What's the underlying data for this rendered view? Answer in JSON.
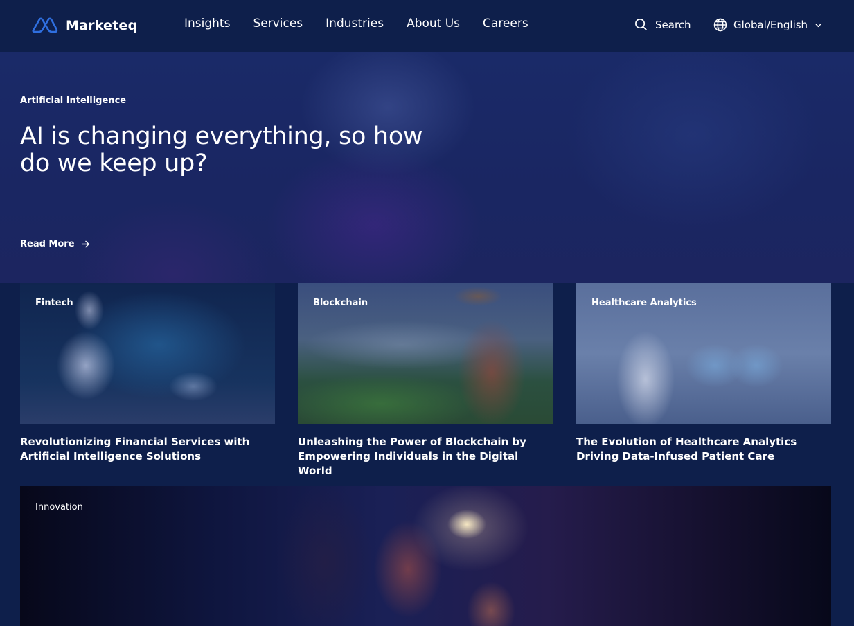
{
  "header": {
    "brand": "Marketeq",
    "brand_color": "#2f6fe0",
    "nav": [
      "Insights",
      "Services",
      "Industries",
      "About Us",
      "Careers"
    ],
    "search_label": "Search",
    "language_label": "Global/English"
  },
  "hero": {
    "category": "Artificial Intelligence",
    "title": "AI is changing everything, so how do we keep up?",
    "cta_label": "Read More"
  },
  "cards": [
    {
      "category": "Fintech",
      "title": "Revolutionizing Financial Services with Artificial Intelligence Solutions"
    },
    {
      "category": "Blockchain",
      "title": "Unleashing the Power of Blockchain by Empowering Individuals in the Digital World"
    },
    {
      "category": "Healthcare Analytics",
      "title": "The Evolution of Healthcare Analytics Driving Data-Infused Patient Care"
    }
  ],
  "feature": {
    "category": "Innovation"
  },
  "colors": {
    "background": "#0e1f4b",
    "text": "#ffffff"
  }
}
